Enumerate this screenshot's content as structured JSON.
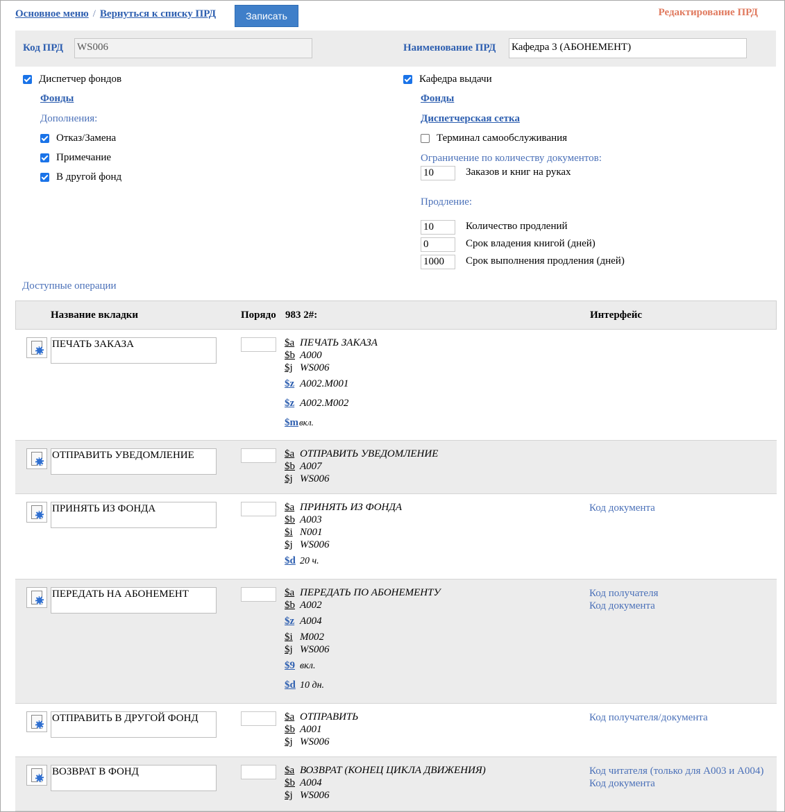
{
  "nav": {
    "main_menu": "Основное меню",
    "sep": "/",
    "back": "Вернуться к списку ПРД",
    "save": "Записать",
    "mode": "Редактирование ПРД"
  },
  "codebar": {
    "code_label": "Код ПРД",
    "code_value": "WS006",
    "name_label": "Наименование ПРД",
    "name_value": "Кафедра 3 (АБОНЕМЕНТ)"
  },
  "left": {
    "dispatcher": "Диспетчер фондов",
    "funds": "Фонды",
    "extras": "Дополнения:",
    "refuse": "Отказ/Замена",
    "note": "Примечание",
    "other_fund": "В другой фонд"
  },
  "right": {
    "desk": "Кафедра выдачи",
    "funds": "Фонды",
    "grid": "Диспетчерская сетка",
    "terminal": "Терминал самообслуживания",
    "limit_title": "Ограничение по количеству документов:",
    "limit_value": "10",
    "limit_label": "Заказов и книг на руках",
    "renew_title": "Продление:",
    "renew_count_value": "10",
    "renew_count_label": "Количество продлений",
    "term_value": "0",
    "term_label": "Срок владения книгой (дней)",
    "renew_term_value": "1000",
    "renew_term_label": "Срок выполнения продления (дней)"
  },
  "ops_title": "Доступные операции",
  "table": {
    "headers": {
      "name": "Название вкладки",
      "order": "Порядо",
      "field": "983 2#:",
      "iface": "Интерфейс"
    },
    "rows": [
      {
        "name": "ПЕЧАТЬ ЗАКАЗА",
        "f": [
          [
            "$a",
            "ПЕЧАТЬ ЗАКАЗА"
          ],
          [
            "$b",
            "А000"
          ],
          [
            "$j",
            "WS006"
          ],
          [
            "$z",
            "А002.М001"
          ],
          [
            "$z",
            "А002.М002"
          ],
          [
            "$m",
            "вкл."
          ]
        ],
        "iface": []
      },
      {
        "name": "ОТПРАВИТЬ УВЕДОМЛЕНИЕ",
        "f": [
          [
            "$a",
            "ОТПРАВИТЬ УВЕДОМЛЕНИЕ"
          ],
          [
            "$b",
            "А007"
          ],
          [
            "$j",
            "WS006"
          ]
        ],
        "iface": []
      },
      {
        "name": "ПРИНЯТЬ ИЗ ФОНДА",
        "f": [
          [
            "$a",
            "ПРИНЯТЬ ИЗ ФОНДА"
          ],
          [
            "$b",
            "А003"
          ],
          [
            "$i",
            "N001"
          ],
          [
            "$j",
            "WS006"
          ],
          [
            "$d",
            "20 ч."
          ]
        ],
        "iface": [
          "Код документа"
        ]
      },
      {
        "name": "ПЕРЕДАТЬ НА АБОНЕМЕНТ",
        "f": [
          [
            "$a",
            "ПЕРЕДАТЬ ПО АБОНЕМЕНТУ"
          ],
          [
            "$b",
            "А002"
          ],
          [
            "$z",
            "А004"
          ],
          [
            "$i",
            "М002"
          ],
          [
            "$j",
            "WS006"
          ],
          [
            "$9",
            "вкл."
          ],
          [
            "$d",
            "10 дн."
          ]
        ],
        "iface": [
          "Код получателя",
          "Код документа"
        ]
      },
      {
        "name": "ОТПРАВИТЬ В ДРУГОЙ ФОНД",
        "f": [
          [
            "$a",
            "ОТПРАВИТЬ"
          ],
          [
            "$b",
            "А001"
          ],
          [
            "$j",
            "WS006"
          ]
        ],
        "iface": [
          "Код получателя/документа"
        ]
      },
      {
        "name": "ВОЗВРАТ В ФОНД",
        "f": [
          [
            "$a",
            "ВОЗВРАТ (КОНЕЦ ЦИКЛА ДВИЖЕНИЯ)"
          ],
          [
            "$b",
            "А004"
          ],
          [
            "$j",
            "WS006"
          ]
        ],
        "iface": [
          "Код читателя (только для А003 и А004)",
          "Код документа"
        ]
      }
    ]
  }
}
